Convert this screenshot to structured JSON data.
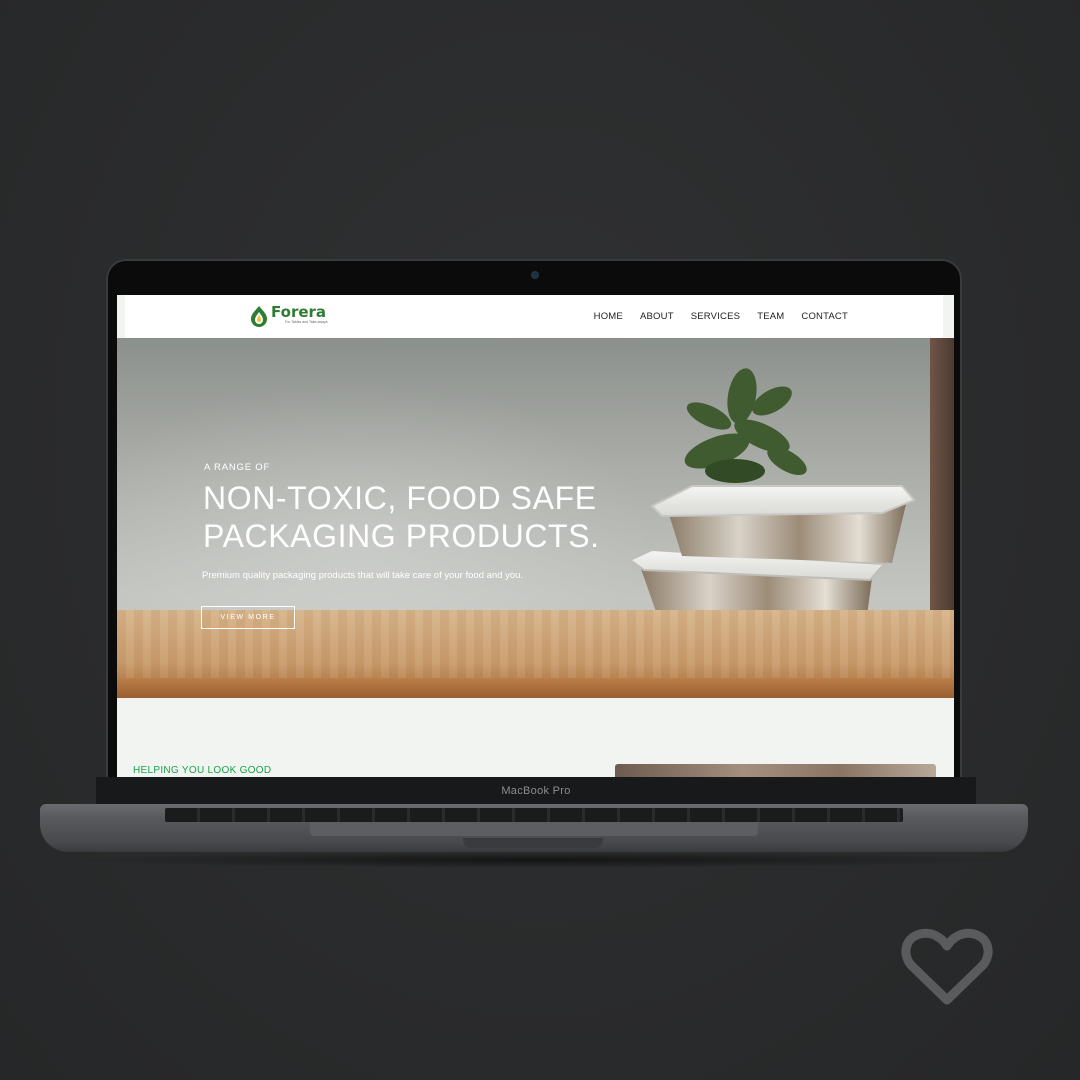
{
  "device": {
    "label": "MacBook Pro"
  },
  "site": {
    "logo": {
      "name": "Forera",
      "tagline": "For Tables and Take-aways"
    },
    "nav": [
      "HOME",
      "ABOUT",
      "SERVICES",
      "TEAM",
      "CONTACT"
    ],
    "hero": {
      "eyebrow": "A RANGE OF",
      "headline_line1": "NON-TOXIC, FOOD SAFE",
      "headline_line2": "PACKAGING PRODUCTS.",
      "subtitle": "Premium quality packaging products that will take care of your food and you.",
      "cta_label": "VIEW MORE"
    },
    "section2": {
      "label": "HELPING YOU LOOK GOOD"
    }
  },
  "colors": {
    "brand_green": "#2e7d32",
    "accent_green": "#16a34a",
    "page_background": "#2a2b2c"
  },
  "icons": {
    "heart": "heart-outline-icon",
    "logo": "leaf-drop-logo-icon"
  }
}
